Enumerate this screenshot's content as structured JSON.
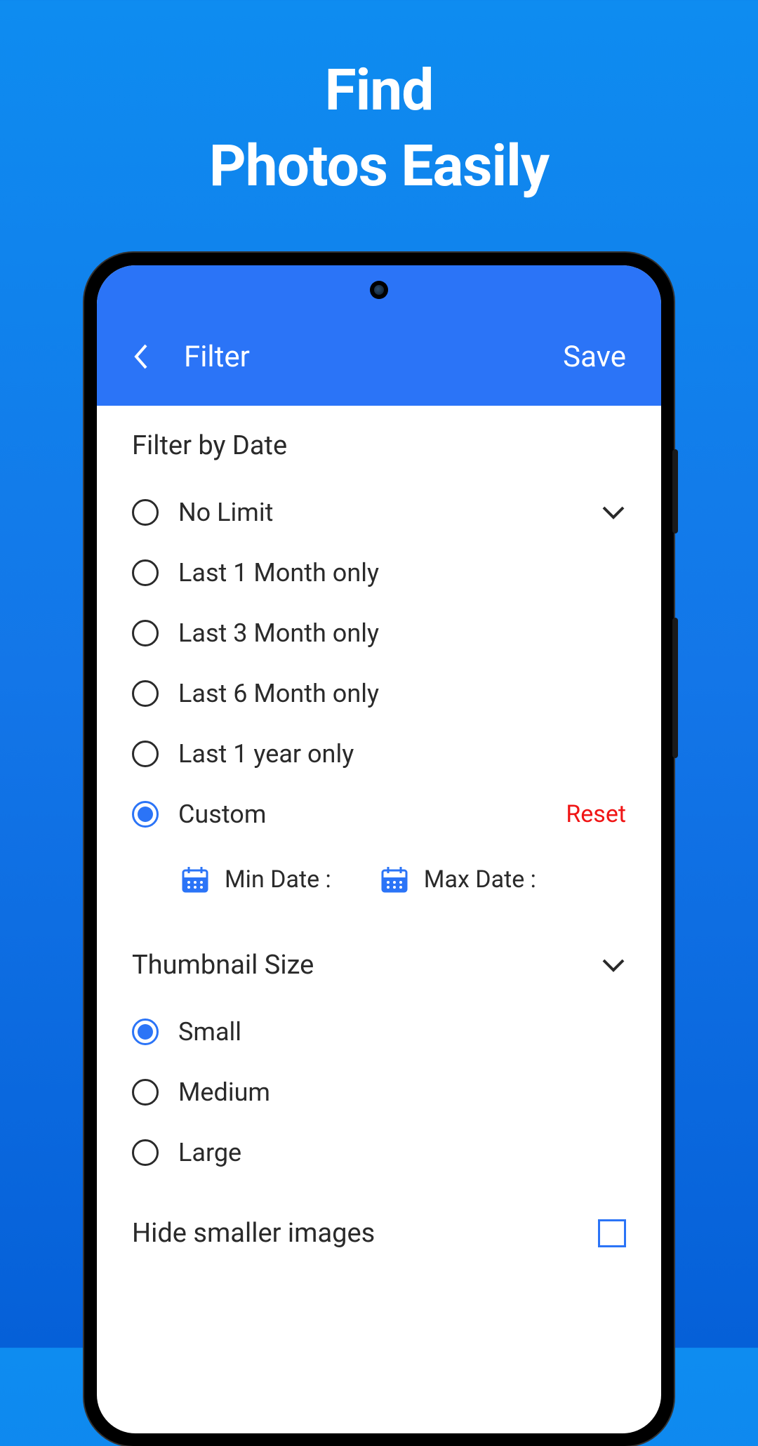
{
  "promo": {
    "line1": "Find",
    "line2": "Photos Easily"
  },
  "header": {
    "title": "Filter",
    "save": "Save"
  },
  "sections": {
    "filterByDate": {
      "title": "Filter by Date",
      "options": [
        {
          "label": "No Limit",
          "selected": false
        },
        {
          "label": "Last 1 Month only",
          "selected": false
        },
        {
          "label": "Last 3 Month only",
          "selected": false
        },
        {
          "label": "Last 6 Month only",
          "selected": false
        },
        {
          "label": "Last 1 year only",
          "selected": false
        },
        {
          "label": "Custom",
          "selected": true
        }
      ],
      "reset": "Reset",
      "minDate": "Min Date :",
      "maxDate": "Max Date :"
    },
    "thumbnailSize": {
      "title": "Thumbnail Size",
      "options": [
        {
          "label": "Small",
          "selected": true
        },
        {
          "label": "Medium",
          "selected": false
        },
        {
          "label": "Large",
          "selected": false
        }
      ]
    },
    "hideSmaller": {
      "title": "Hide smaller images"
    }
  }
}
